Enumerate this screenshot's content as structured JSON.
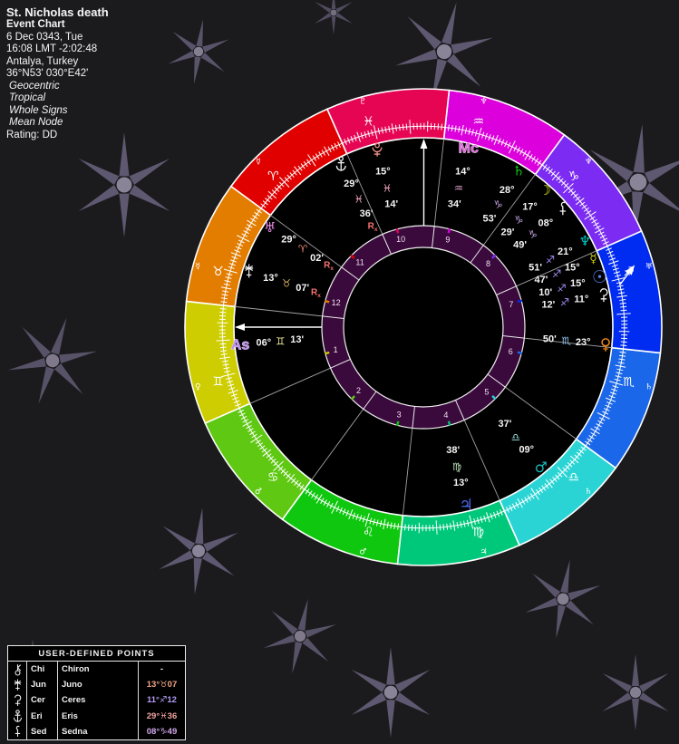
{
  "header": {
    "title": "St. Nicholas death",
    "subtitle": "Event Chart",
    "lines": [
      "6 Dec 0343, Tue",
      "16:08 LMT -2:02:48",
      "Antalya, Turkey",
      "36°N53' 030°E42'"
    ],
    "italic_lines": [
      "Geocentric",
      "Tropical",
      "Whole Signs",
      "Mean Node"
    ],
    "rating": "Rating: DD"
  },
  "wheel": {
    "signs": [
      {
        "name": "aries",
        "glyph": "♈",
        "color": "#E00000",
        "rim_glyph": "☿"
      },
      {
        "name": "taurus",
        "glyph": "♉",
        "color": "#E27D00",
        "rim_glyph": "☿"
      },
      {
        "name": "gemini",
        "glyph": "♊",
        "color": "#CDCD01",
        "rim_glyph": "♀"
      },
      {
        "name": "cancer",
        "glyph": "♋",
        "color": "#5FC813",
        "rim_glyph": "♂"
      },
      {
        "name": "leo",
        "glyph": "♌",
        "color": "#0FC70F",
        "rim_glyph": "♂"
      },
      {
        "name": "virgo",
        "glyph": "♍",
        "color": "#00C87A",
        "rim_glyph": "♃"
      },
      {
        "name": "libra",
        "glyph": "♎",
        "color": "#2BD4D4",
        "rim_glyph": "♄"
      },
      {
        "name": "scorpio",
        "glyph": "♏",
        "color": "#1A67E9",
        "rim_glyph": "♄"
      },
      {
        "name": "sagittarius",
        "glyph": "♐",
        "color": "#002BF0",
        "rim_glyph": "♅"
      },
      {
        "name": "capricorn",
        "glyph": "♑",
        "color": "#7B2BF2",
        "rim_glyph": "♆"
      },
      {
        "name": "aquarius",
        "glyph": "♒",
        "color": "#DC00DC",
        "rim_glyph": "♆"
      },
      {
        "name": "pisces",
        "glyph": "♓",
        "color": "#E60553",
        "rim_glyph": "♇"
      }
    ],
    "houses": [
      "1",
      "2",
      "3",
      "4",
      "5",
      "6",
      "7",
      "8",
      "9",
      "10",
      "11",
      "12"
    ],
    "house_ring_color": "#3A0A3C",
    "points": [
      {
        "id": "pluto",
        "glyph": "",
        "symbol": "pluto",
        "deg": "15°",
        "sign": "♓",
        "min": "14'",
        "retro": false,
        "color": "#F2948C",
        "sign_color": "#F7A8C8"
      },
      {
        "id": "eris",
        "glyph": "",
        "symbol": "eris",
        "deg": "29°",
        "sign": "♓",
        "min": "36'",
        "retro": true,
        "color": "#F2F2F2",
        "sign_color": "#F7A8C8"
      },
      {
        "id": "uranus",
        "glyph": "♅",
        "symbol": "",
        "deg": "29°",
        "sign": "♈",
        "min": "02'",
        "retro": true,
        "color": "#F08CF0",
        "sign_color": "#F08878"
      },
      {
        "id": "juno",
        "glyph": "",
        "symbol": "juno",
        "deg": "13°",
        "sign": "♉",
        "min": "07'",
        "retro": true,
        "color": "#F2F2F2",
        "sign_color": "#D8B060"
      },
      {
        "id": "jupiter",
        "glyph": "♃",
        "symbol": "",
        "deg": "13°",
        "sign": "♍",
        "min": "38'",
        "retro": false,
        "color": "#4A6CF0",
        "sign_color": "#BFE3BF"
      },
      {
        "id": "mars",
        "glyph": "♂",
        "symbol": "",
        "deg": "09°",
        "sign": "♎",
        "min": "37'",
        "retro": false,
        "color": "#19B8B8",
        "sign_color": "#9FE6E6"
      },
      {
        "id": "venus",
        "glyph": "♀",
        "symbol": "",
        "deg": "23°",
        "sign": "♏",
        "min": "50'",
        "retro": false,
        "color": "#F28718",
        "sign_color": "#8FC6F2"
      },
      {
        "id": "ceres",
        "glyph": "",
        "symbol": "ceres",
        "deg": "11°",
        "sign": "♐",
        "min": "12'",
        "retro": false,
        "color": "#F2F2F2",
        "sign_color": "#A78CF6"
      },
      {
        "id": "sun",
        "glyph": "☉",
        "symbol": "",
        "deg": "15°",
        "sign": "♐",
        "min": "10'",
        "retro": false,
        "color": "#5C80F2",
        "sign_color": "#A78CF6"
      },
      {
        "id": "mercury",
        "glyph": "☿",
        "symbol": "",
        "deg": "15°",
        "sign": "♐",
        "min": "47'",
        "retro": false,
        "color": "#CFCF10",
        "sign_color": "#A78CF6"
      },
      {
        "id": "neptune",
        "glyph": "♆",
        "symbol": "",
        "deg": "21°",
        "sign": "♐",
        "min": "51'",
        "retro": false,
        "color": "#00C9C9",
        "sign_color": "#A78CF6"
      },
      {
        "id": "sedna",
        "glyph": "",
        "symbol": "sedna",
        "deg": "08°",
        "sign": "♑",
        "min": "49'",
        "retro": false,
        "color": "#F2F2F2",
        "sign_color": "#C9A6E3"
      },
      {
        "id": "moon",
        "glyph": "☽",
        "symbol": "",
        "deg": "17°",
        "sign": "♑",
        "min": "29'",
        "retro": false,
        "color": "#E8E813",
        "sign_color": "#C9A6E3"
      },
      {
        "id": "saturn",
        "glyph": "♄",
        "symbol": "",
        "deg": "28°",
        "sign": "♑",
        "min": "53'",
        "retro": false,
        "color": "#15C715",
        "sign_color": "#C9A6E3"
      }
    ],
    "angle_points": [
      {
        "id": "asc",
        "label": "As",
        "deg": "06°",
        "sign": "♊",
        "min": "13'",
        "color": "#B98CF2",
        "sign_color": "#EDE79A"
      },
      {
        "id": "mc",
        "label": "Mc",
        "deg": "14°",
        "sign": "♒",
        "min": "34'",
        "color": "#E06CE0",
        "sign_color": "#EDA8DC"
      }
    ],
    "retro_label": "R",
    "retro_sub": "x",
    "retro_color": "#F87070"
  },
  "table": {
    "title": "USER-DEFINED POINTS",
    "rows": [
      {
        "abbr": "Chi",
        "name": "Chiron",
        "symbol": "chiron",
        "value_deg": "",
        "value_sign": "",
        "value_min": "-",
        "value_color": "#F0F0F0"
      },
      {
        "abbr": "Jun",
        "name": "Juno",
        "symbol": "juno",
        "value_deg": "13°",
        "value_sign": "♉",
        "value_min": "07",
        "value_color": "#F2A586"
      },
      {
        "abbr": "Cer",
        "name": "Ceres",
        "symbol": "ceres",
        "value_deg": "11°",
        "value_sign": "♐",
        "value_min": "12",
        "value_color": "#B49CF2"
      },
      {
        "abbr": "Eri",
        "name": "Eris",
        "symbol": "eris",
        "value_deg": "29°",
        "value_sign": "♓",
        "value_min": "36",
        "value_color": "#F2A6A0"
      },
      {
        "abbr": "Sed",
        "name": "Sedna",
        "symbol": "sedna",
        "value_deg": "08°",
        "value_sign": "♑",
        "value_min": "49",
        "value_color": "#D2A8EC"
      }
    ]
  }
}
